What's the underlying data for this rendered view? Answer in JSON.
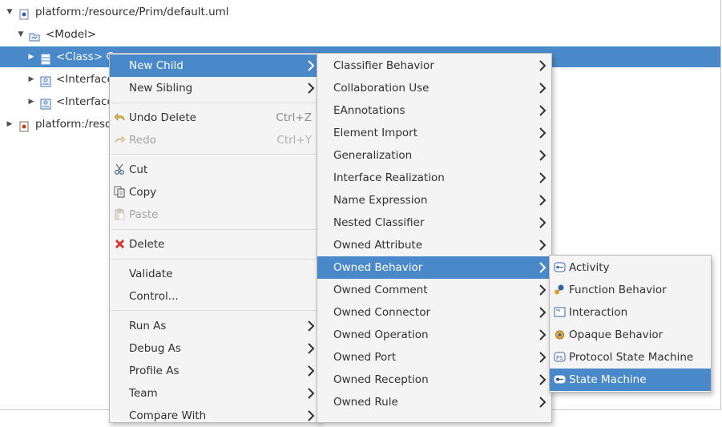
{
  "tree": {
    "file": "platform:/resource/Prim/default.uml",
    "model": "<Model>",
    "class_item": "<Class> C",
    "class_item_tail": "Cl",
    "interface1": "<Interface",
    "interface2": "<Interface",
    "platform2": "platform:/reso"
  },
  "context_menu": {
    "new_child": "New Child",
    "new_sibling": "New Sibling",
    "undo": "Undo Delete",
    "undo_shortcut": "Ctrl+Z",
    "redo": "Redo",
    "redo_shortcut": "Ctrl+Y",
    "cut": "Cut",
    "copy": "Copy",
    "paste": "Paste",
    "delete": "Delete",
    "validate": "Validate",
    "control": "Control...",
    "run_as": "Run As",
    "debug_as": "Debug As",
    "profile_as": "Profile As",
    "team": "Team",
    "compare_with": "Compare With"
  },
  "child_menu": [
    "Classifier Behavior",
    "Collaboration Use",
    "EAnnotations",
    "Element Import",
    "Generalization",
    "Interface Realization",
    "Name Expression",
    "Nested Classifier",
    "Owned Attribute",
    "Owned Behavior",
    "Owned Comment",
    "Owned Connector",
    "Owned Operation",
    "Owned Port",
    "Owned Reception",
    "Owned Rule"
  ],
  "behavior_menu": [
    "Activity",
    "Function Behavior",
    "Interaction",
    "Opaque Behavior",
    "Protocol State Machine",
    "State Machine"
  ],
  "colors": {
    "selection": "#4a89c9",
    "menu_bg": "#f4f4f4"
  }
}
